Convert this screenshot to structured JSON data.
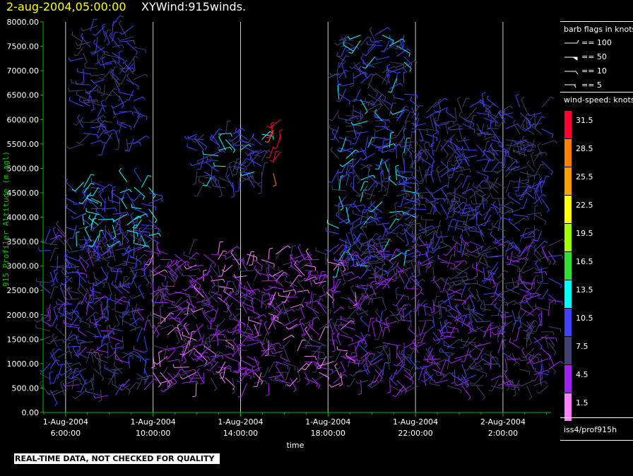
{
  "header": {
    "date_label": "2-aug-2004,05:00:00",
    "plot_name": "XYWind:915winds."
  },
  "quality_note": "REAL-TIME DATA, NOT CHECKED FOR QUALITY",
  "legend": {
    "barb_title": "barb flags in knots",
    "barb_items": [
      "== 100",
      "== 50",
      "== 10",
      "== 5"
    ],
    "speed_title": "wind-speed: knots",
    "speed_bins": [
      {
        "label": "31.5",
        "color": "#ff0030"
      },
      {
        "label": "28.5",
        "color": "#ff8000"
      },
      {
        "label": "25.5",
        "color": "#ffa000"
      },
      {
        "label": "22.5",
        "color": "#ffff00"
      },
      {
        "label": "19.5",
        "color": "#a0ff00"
      },
      {
        "label": "16.5",
        "color": "#30e030"
      },
      {
        "label": "13.5",
        "color": "#00ffff"
      },
      {
        "label": "10.5",
        "color": "#4040ff"
      },
      {
        "label": "7.5",
        "color": "#404070"
      },
      {
        "label": "4.5",
        "color": "#a020f0"
      },
      {
        "label": "1.5",
        "color": "#ff80ff"
      }
    ],
    "source": "iss4/prof915h"
  },
  "chart_data": {
    "type": "scatter",
    "title": "XYWind:915winds.",
    "xlabel": "time",
    "ylabel": "915 Profiler Altitude (m agl)",
    "ylim": [
      0,
      8000
    ],
    "y_ticks": [
      "0.00",
      "500.00",
      "1000.00",
      "1500.00",
      "2000.00",
      "2500.00",
      "3000.00",
      "3500.00",
      "4000.00",
      "4500.00",
      "5000.00",
      "5500.00",
      "6000.00",
      "6500.00",
      "7000.00",
      "7500.00",
      "8000.00"
    ],
    "x_ticks": [
      {
        "line1": "1-Aug-2004",
        "line2": "6:00:00"
      },
      {
        "line1": "1-Aug-2004",
        "line2": "10:00:00"
      },
      {
        "line1": "1-Aug-2004",
        "line2": "14:00:00"
      },
      {
        "line1": "1-Aug-2004",
        "line2": "18:00:00"
      },
      {
        "line1": "1-Aug-2004",
        "line2": "22:00:00"
      },
      {
        "line1": "2-Aug-2004",
        "line2": "2:00:00"
      }
    ],
    "xlim_hours_since_aug1_0000": [
      4.97,
      28.2
    ],
    "x_tick_hours": [
      6,
      10,
      14,
      18,
      22,
      26
    ],
    "grid": "vertical lines at each time tick",
    "series": [
      {
        "hour_range": [
          5.3,
          9.8
        ],
        "alt_range": [
          350,
          3800
        ],
        "speed_kt": 8,
        "note": "dense low-level barbs"
      },
      {
        "hour_range": [
          6.5,
          10.0
        ],
        "alt_range": [
          3400,
          4800
        ],
        "speed_kt": 12
      },
      {
        "hour_range": [
          6.8,
          9.2
        ],
        "alt_range": [
          5500,
          8000
        ],
        "speed_kt": 9
      },
      {
        "hour_range": [
          10.0,
          19.5
        ],
        "alt_range": [
          600,
          3300
        ],
        "speed_kt": 5
      },
      {
        "hour_range": [
          12.0,
          15.0
        ],
        "alt_range": [
          4600,
          5700
        ],
        "speed_kt": 10
      },
      {
        "hour_range": [
          15.5,
          16.0
        ],
        "alt_range": [
          4900,
          6000
        ],
        "speed_kt": 31
      },
      {
        "hour_range": [
          18.5,
          21.6
        ],
        "alt_range": [
          3000,
          7800
        ],
        "speed_kt": 10
      },
      {
        "hour_range": [
          19.5,
          28.2
        ],
        "alt_range": [
          550,
          3500
        ],
        "speed_kt": 7
      },
      {
        "hour_range": [
          21.5,
          28.0
        ],
        "alt_range": [
          3500,
          6300
        ],
        "speed_kt": 9
      }
    ]
  }
}
